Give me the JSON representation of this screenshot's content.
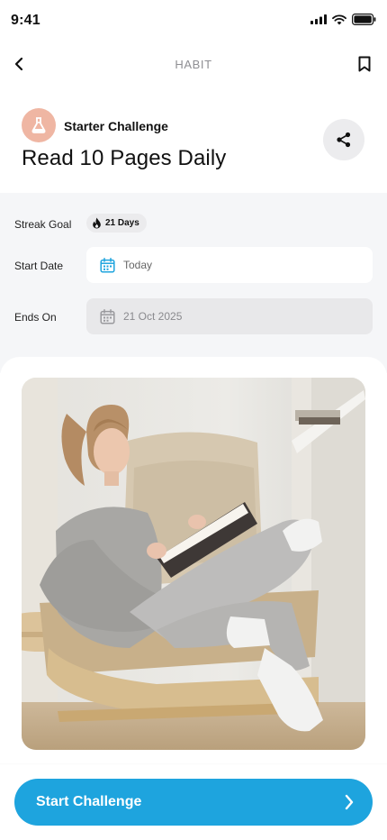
{
  "status_bar": {
    "time": "9:41"
  },
  "nav": {
    "title": "HABIT"
  },
  "challenge": {
    "label": "Starter Challenge",
    "title": "Read 10 Pages Daily"
  },
  "form": {
    "streak_goal_label": "Streak Goal",
    "streak_goal_value": "21 Days",
    "start_date_label": "Start Date",
    "start_date_value": "Today",
    "ends_on_label": "Ends On",
    "ends_on_value": "21 Oct 2025"
  },
  "cta": {
    "label": "Start Challenge"
  },
  "colors": {
    "accent": "#1ea4de",
    "badge": "#efb6a3",
    "calendar_active": "#1ea4de",
    "calendar_disabled": "#9a9a9e"
  },
  "icons": [
    "back-chevron-icon",
    "bookmark-icon",
    "flask-icon",
    "share-icon",
    "flame-icon",
    "calendar-icon",
    "chevron-right-icon"
  ]
}
